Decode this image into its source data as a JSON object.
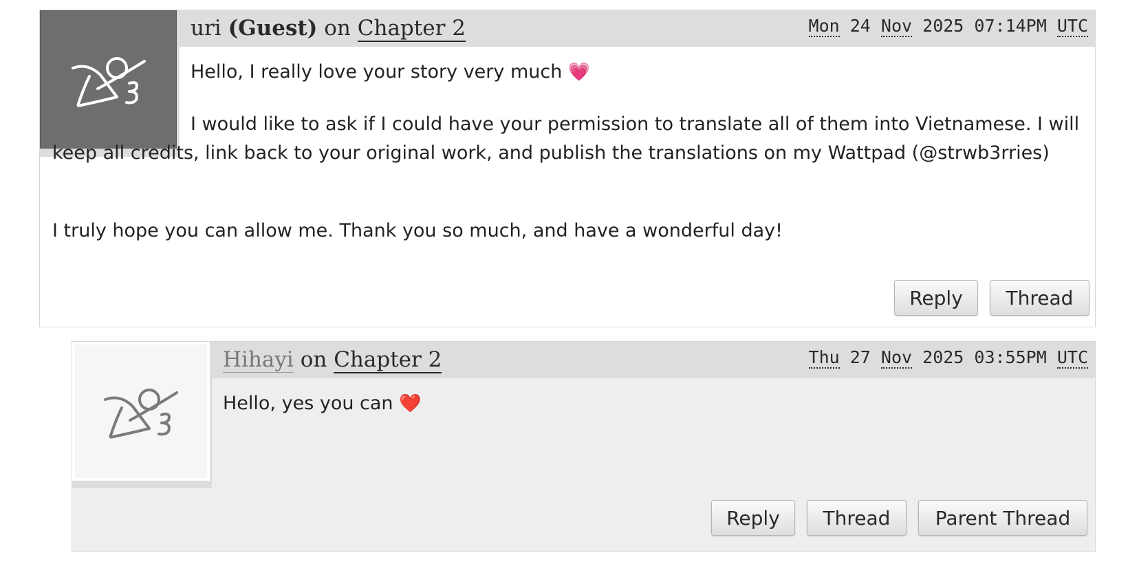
{
  "comments": [
    {
      "author": "uri",
      "guest_label": "(Guest)",
      "on_word": "on",
      "chapter": "Chapter 2",
      "date": {
        "weekday": "Mon",
        "day": "24",
        "month": "Nov",
        "year": "2025",
        "time": "07:14PM",
        "timezone": "UTC"
      },
      "paragraphs": [
        "Hello, I really love your story very much",
        "I would like to ask if I could have your permission to translate all of them into Vietnamese. I will keep all credits, link back to your original work, and publish the translations on my Wattpad (@strwb3rries)",
        "I truly hope you can allow me. Thank you so much, and have a wonderful day!"
      ],
      "emoji": "💗",
      "icon": "default-user-icon",
      "buttons": {
        "reply": "Reply",
        "thread": "Thread"
      }
    },
    {
      "author": "Hihayi",
      "on_word": "on",
      "chapter": "Chapter 2",
      "date": {
        "weekday": "Thu",
        "day": "27",
        "month": "Nov",
        "year": "2025",
        "time": "03:55PM",
        "timezone": "UTC"
      },
      "paragraphs": [
        "Hello, yes you can"
      ],
      "emoji": "❤️",
      "icon": "default-user-icon",
      "buttons": {
        "reply": "Reply",
        "thread": "Thread",
        "parent_thread": "Parent Thread"
      }
    }
  ],
  "colors": {
    "header_bg": "#dddddd",
    "reply_bg": "#eeeeee",
    "guest_icon_bg": "#6e6e6e"
  }
}
